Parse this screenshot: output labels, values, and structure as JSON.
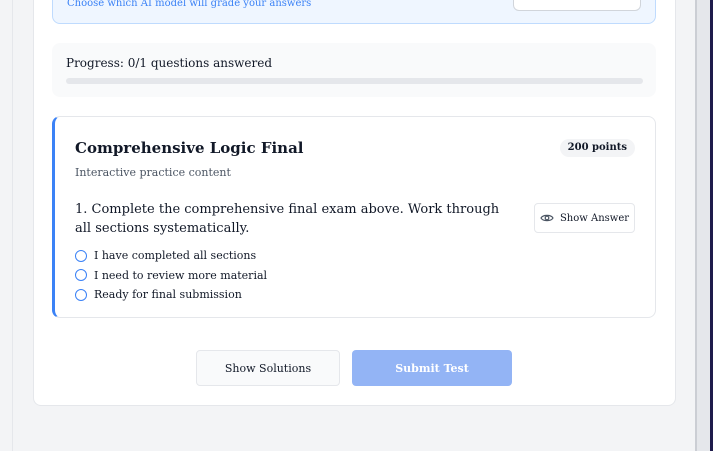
{
  "model_panel": {
    "hint": "Choose which AI model will grade your answers"
  },
  "progress": {
    "label": "Progress: 0/1 questions answered",
    "answered": 0,
    "total": 1,
    "fill_fraction": 0,
    "fill_color": "#3b82f6"
  },
  "question": {
    "title": "Comprehensive Logic Final",
    "points": "200 points",
    "subtitle": "Interactive practice content",
    "text": "1. Complete the comprehensive final exam above. Work through all sections systematically.",
    "show_answer_label": "Show Answer",
    "show_answer_icon": "eye-icon",
    "options": [
      "I have completed all sections",
      "I need to review more material",
      "Ready for final submission"
    ],
    "accent_color": "#3b82f6"
  },
  "actions": {
    "show_solutions_label": "Show Solutions",
    "submit_label": "Submit Test",
    "submit_color": "#93b4f5"
  }
}
